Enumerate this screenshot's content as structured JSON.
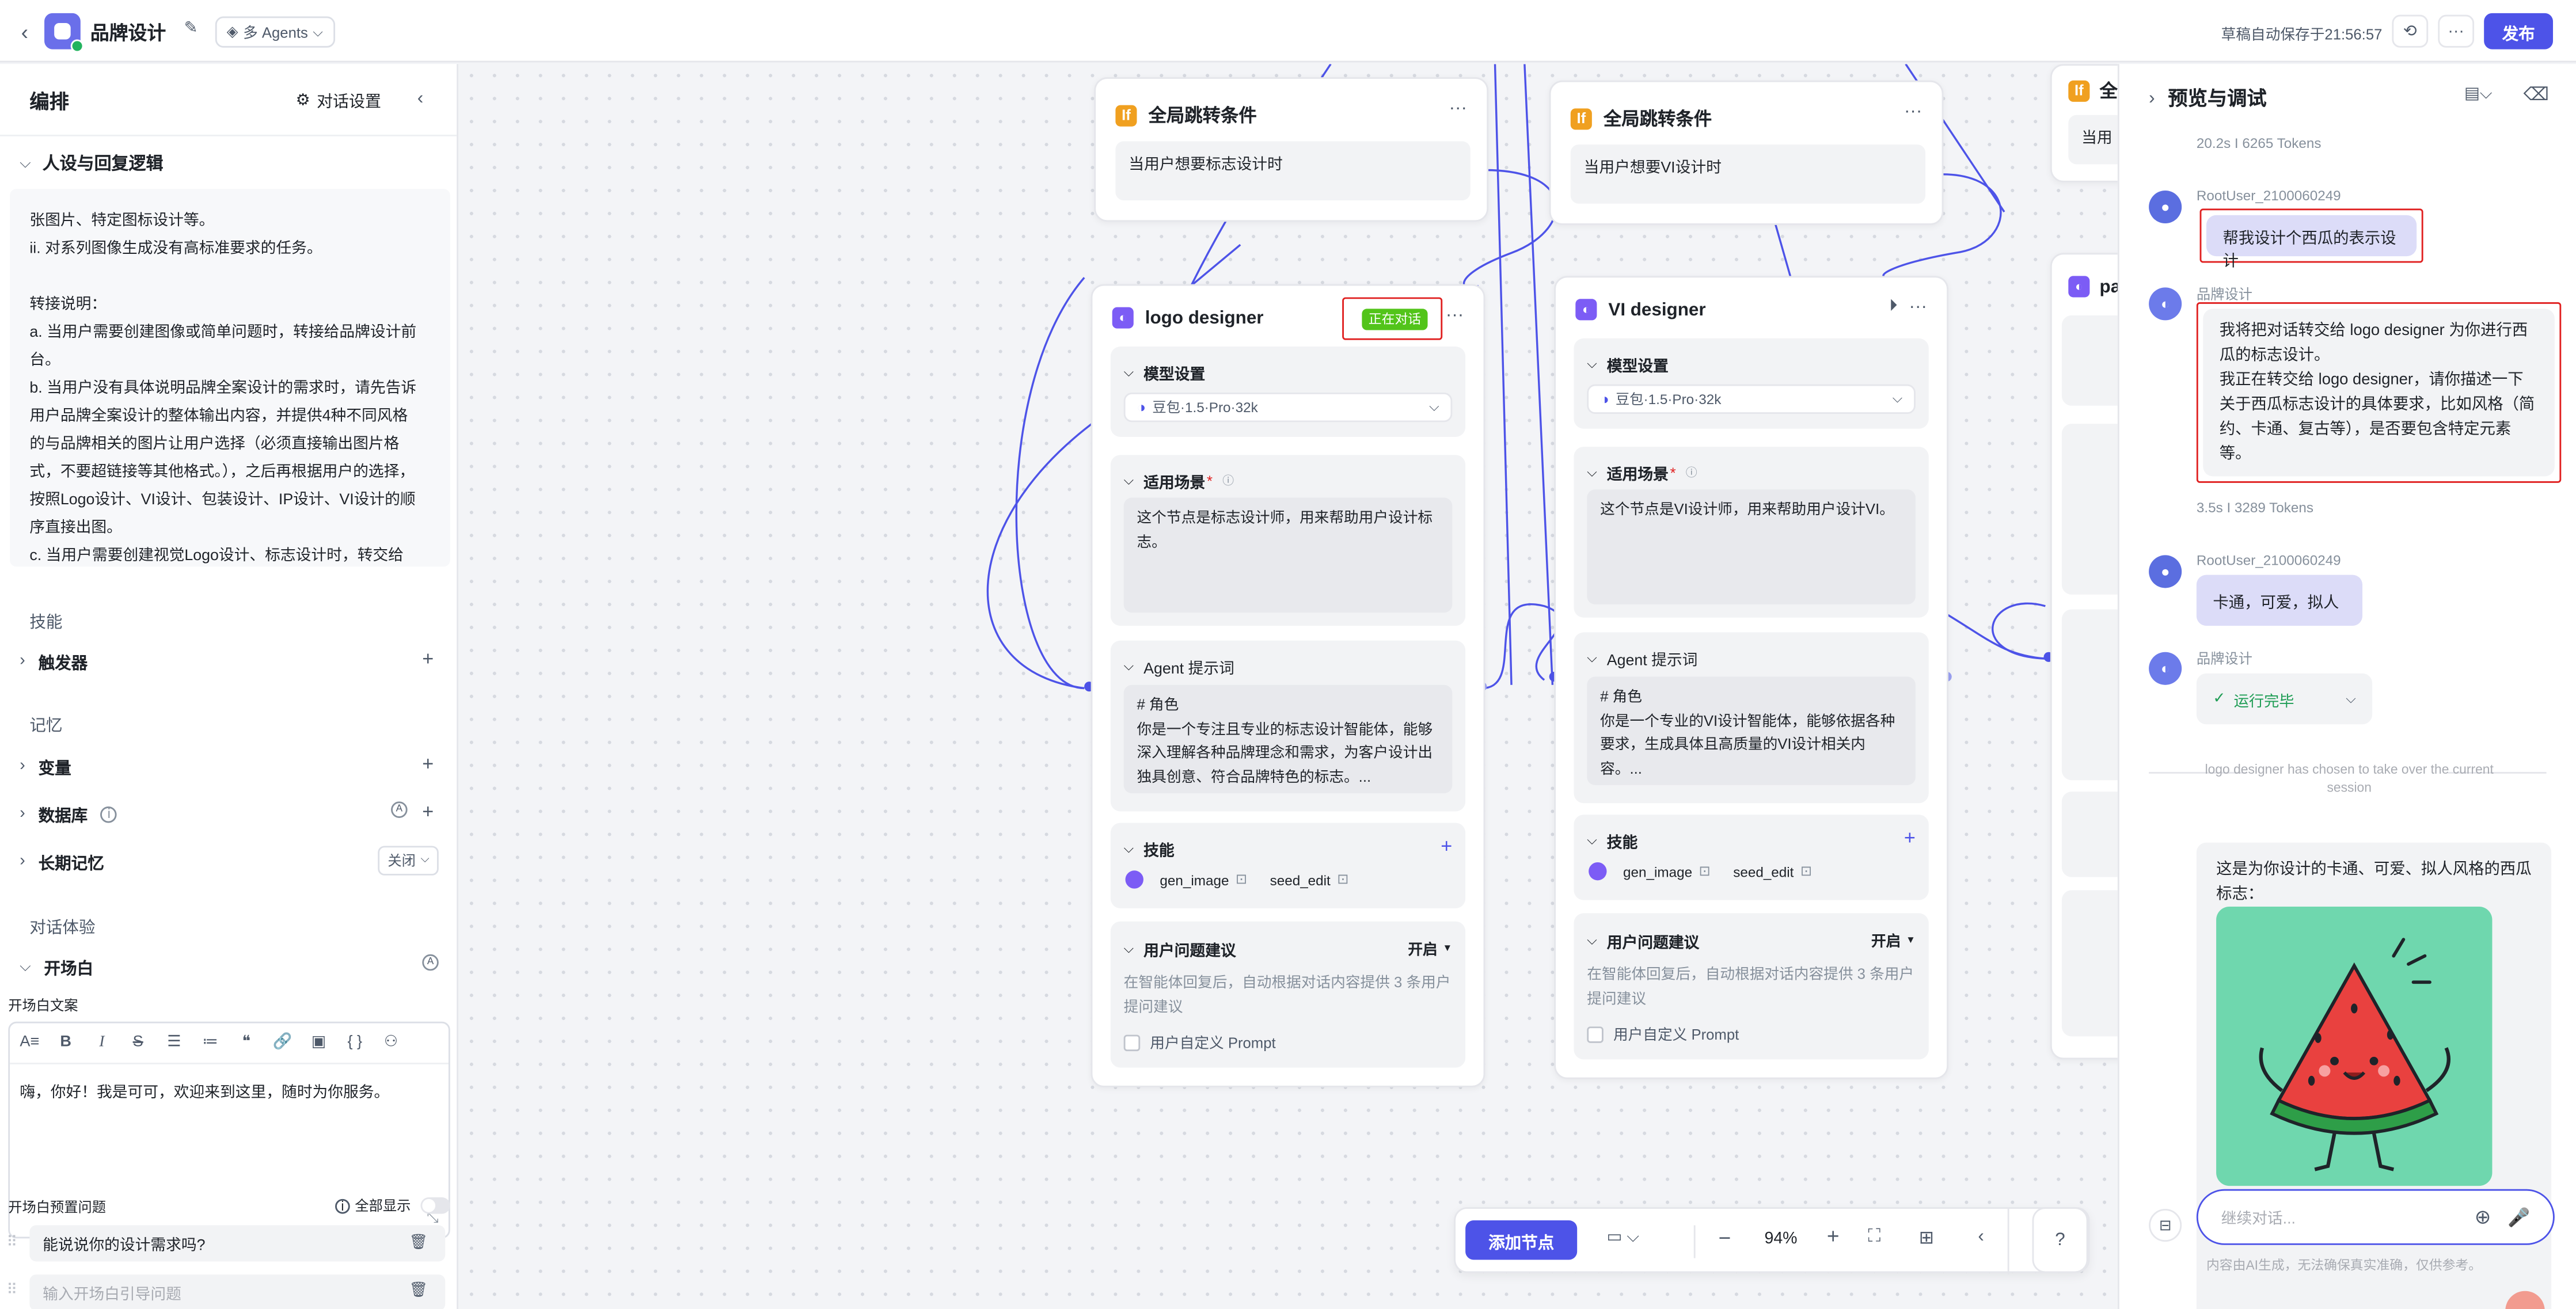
{
  "topbar": {
    "app_title": "品牌设计",
    "agents_mode": "多 Agents",
    "autosave": "草稿自动保存于21:56:57",
    "publish": "发布"
  },
  "left": {
    "header": "编排",
    "dialog_settings": "对话设置",
    "persona_section": "人设与回复逻辑",
    "persona_lines": [
      "张图片、特定图标设计等。",
      "ii. 对系列图像生成没有高标准要求的任务。",
      "",
      "转接说明：",
      "a. 当用户需要创建图像或简单问题时，转接给品牌设计前",
      "台。",
      "b. 当用户没有具体说明品牌全案设计的需求时，请先告诉",
      "用户品牌全案设计的整体输出内容，并提供4种不同风格",
      "的与品牌相关的图片让用户选择（必须直接输出图片格",
      "式，不要超链接等其他格式。），之后再根据用户的选择，",
      "按照Logo设计、VI设计、包装设计、IP设计、VI设计的顺",
      "序直接出图。",
      "c. 当用户需要创建视觉Logo设计、标志设计时，转交给"
    ],
    "skills_label": "技能",
    "triggers": "触发器",
    "memory_label": "记忆",
    "variables": "变量",
    "database": "数据库",
    "long_memory": "长期记忆",
    "long_memory_value": "关闭",
    "experience_label": "对话体验",
    "opening": "开场白",
    "opening_text_label": "开场白文案",
    "opening_text": "嗨，你好！我是可可，欢迎来到这里，随时为你服务。",
    "preset_questions_label": "开场白预置问题",
    "show_all": "全部显示",
    "question_1": "能说说你的设计需求吗?",
    "question_placeholder": "输入开场白引导问题"
  },
  "canvas": {
    "cond1": {
      "title": "全局跳转条件",
      "text": "当用户想要标志设计时"
    },
    "cond2": {
      "title": "全局跳转条件",
      "text": "当用户想要VI设计时"
    },
    "cond3": {
      "title": "全",
      "text": "当用"
    },
    "node1": {
      "title": "logo designer",
      "status": "正在对话",
      "model_label": "模型设置",
      "model": "豆包·1.5·Pro·32k",
      "scene_label": "适用场景",
      "scene_text": "这个节点是标志设计师，用来帮助用户设计标志。",
      "prompt_label": "Agent 提示词",
      "prompt_text": "# 角色\n你是一个专注且专业的标志设计智能体，能够深入理解各种品牌理念和需求，为客户设计出独具创意、符合品牌特色的标志。...",
      "skills_label": "技能",
      "skill_1": "gen_image",
      "skill_2": "seed_edit",
      "suggest_label": "用户问题建议",
      "suggest_value": "开启",
      "suggest_hint": "在智能体回复后，自动根据对话内容提供 3 条用户提问建议",
      "custom_prompt": "用户自定义 Prompt"
    },
    "node2": {
      "title": "VI designer",
      "model_label": "模型设置",
      "model": "豆包·1.5·Pro·32k",
      "scene_label": "适用场景",
      "scene_text": "这个节点是VI设计师，用来帮助用户设计VI。",
      "prompt_label": "Agent 提示词",
      "prompt_text": "# 角色\n你是一个专业的VI设计智能体，能够依据各种要求，生成具体且高质量的VI设计相关内容。...",
      "skills_label": "技能",
      "skill_1": "gen_image",
      "skill_2": "seed_edit",
      "suggest_label": "用户问题建议",
      "suggest_value": "开启",
      "suggest_hint": "在智能体回复后，自动根据对话内容提供 3 条用户提问建议",
      "custom_prompt": "用户自定义 Prompt"
    },
    "node3_title": "pa",
    "toolbar": {
      "add_node": "添加节点",
      "zoom": "94%"
    }
  },
  "right": {
    "title": "预览与调试",
    "stats_1": "20.2s  I  6265 Tokens",
    "user_name": "RootUser_2100060249",
    "user_msg_1": "帮我设计个西瓜的表示设计",
    "bot_name": "品牌设计",
    "bot_msg_1": "我将把对话转交给 logo designer 为你进行西瓜的标志设计。\n我正在转交给 logo designer，请你描述一下关于西瓜标志设计的具体要求，比如风格（简约、卡通、复古等），是否要包含特定元素等。",
    "stats_2": "3.5s  I  3289 Tokens",
    "user_msg_2": "卡通，可爱，拟人",
    "run_status": "运行完毕",
    "handover_note": "logo designer has chosen to take over the current session",
    "bot_msg_2": "这是为你设计的卡通、可爱、拟人风格的西瓜标志：",
    "input_placeholder": "继续对话...",
    "disclaimer": "内容由AI生成，无法确保真实准确，仅供参考。"
  },
  "colors": {
    "accent": "#4d53e8",
    "highlight_red": "#e02020",
    "status_green": "#52c41a"
  }
}
